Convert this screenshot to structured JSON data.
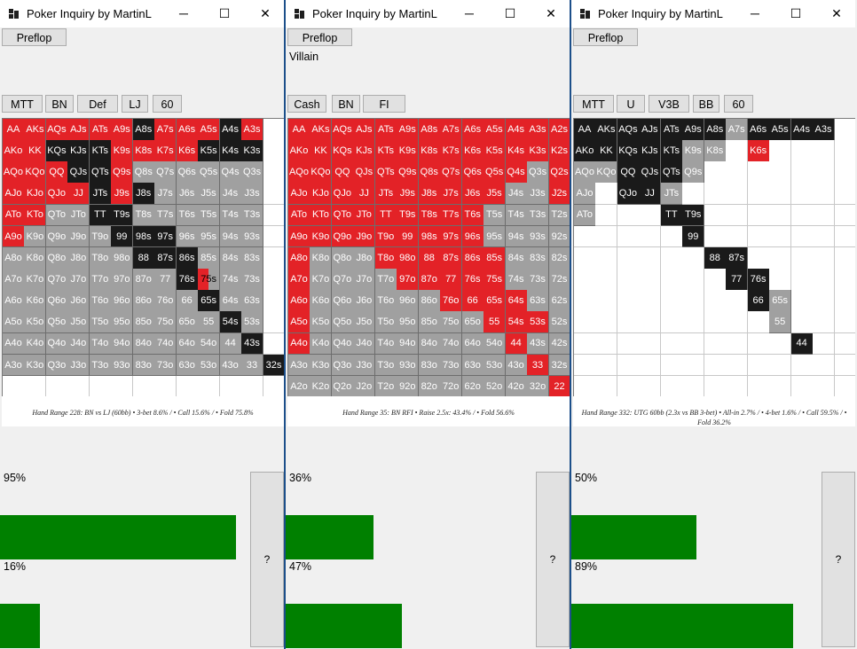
{
  "windows": [
    {
      "title": "Poker Inquiry by MartinL",
      "preflop_label": "Preflop",
      "villain_label": "",
      "tags": [
        "MTT",
        "BN",
        "Def",
        "LJ",
        "60"
      ],
      "range_caption": "Hand Range 228: BN vs LJ (60bb) • 3-bet 8.6% / • Call 15.6% / • Fold 75.8%",
      "meters": [
        {
          "label": "95%",
          "fill": 0.83
        },
        {
          "label": "16%",
          "fill": 0.14
        }
      ],
      "question_label": "?",
      "grid": [
        "RRRRRRKRRRKR",
        "RRKKKRRRRKKK",
        "RRRKKRGGGGGG",
        "RRRRKRKGGGGG",
        "RRGGKKGGGGGG",
        "RGGGGKKKGGGG",
        "GGGGGGKKKGGG",
        "GGGGGGGGKSGG",
        "GGGGGGGGGKGG",
        "GGGGGGGGGGKG",
        "GGGGGGGGGGGK",
        "GGGGGGGGGGGGK"
      ]
    },
    {
      "title": "Poker Inquiry by MartinL",
      "preflop_label": "Preflop",
      "villain_label": "Villain",
      "tags": [
        "Cash",
        "BN",
        "FI"
      ],
      "range_caption": "Hand Range 35: BN RFI • Raise 2.5x: 43.4% / • Fold 56.6%",
      "meters": [
        {
          "label": "36%",
          "fill": 0.31
        },
        {
          "label": "47%",
          "fill": 0.41
        }
      ],
      "question_label": "?",
      "grid": [
        "RRRRRRRRRRRRR",
        "RRRRRRRRRRRRR",
        "RRRRRRRRRRRGR",
        "RRRRRRRRRRGGR",
        "RRRRRRRRRGGGG",
        "RRRRRRRRRGGGG",
        "RGGGRRRRRRGGG",
        "RGGGGRRRRRGGG",
        "RGGGGGGRRRRGG",
        "RGGGGGGGGRRRG",
        "RGGGGGGGGGRGG",
        "GGGGGGGGGGGRG",
        "GGGGGGGGGGGGR"
      ]
    },
    {
      "title": "Poker Inquiry by MartinL",
      "preflop_label": "Preflop",
      "villain_label": "",
      "tags": [
        "MTT",
        "U",
        "V3B",
        "BB",
        "60"
      ],
      "range_caption": "Hand Range 332: UTG 60bb (2.3x vs BB 3-bet) • All-in 2.7% / • 4-bet 1.6% / • Call 59.5% / • Fold 36.2%",
      "meters": [
        {
          "label": "50%",
          "fill": 0.44
        },
        {
          "label": "89%",
          "fill": 0.78
        }
      ],
      "question_label": "?",
      "grid": [
        "KKKKKKKGKKKKW",
        "KKKKKGGWRWWWW",
        "GGKKKGWWWWWWW",
        "GWKKGWWWWWWWW",
        "GWWWKKWWWWWWW",
        "WWWWWKWWWWWWW",
        "WWWWWWKKWWWWW",
        "WWWWWWWKKWWWW",
        "WWWWWWWWKGWWW",
        "WWWWWWWWWGWWW",
        "WWWWWWWWWWKWW",
        "WWWWWWWWWWWWW",
        "WWWWWWWWWWWWW"
      ]
    }
  ],
  "hands": [
    [
      "AA",
      "AKs",
      "AQs",
      "AJs",
      "ATs",
      "A9s",
      "A8s",
      "A7s",
      "A6s",
      "A5s",
      "A4s",
      "A3s",
      "A2s"
    ],
    [
      "AKo",
      "KK",
      "KQs",
      "KJs",
      "KTs",
      "K9s",
      "K8s",
      "K7s",
      "K6s",
      "K5s",
      "K4s",
      "K3s",
      "K2s"
    ],
    [
      "AQo",
      "KQo",
      "QQ",
      "QJs",
      "QTs",
      "Q9s",
      "Q8s",
      "Q7s",
      "Q6s",
      "Q5s",
      "Q4s",
      "Q3s",
      "Q2s"
    ],
    [
      "AJo",
      "KJo",
      "QJo",
      "JJ",
      "JTs",
      "J9s",
      "J8s",
      "J7s",
      "J6s",
      "J5s",
      "J4s",
      "J3s",
      "J2s"
    ],
    [
      "ATo",
      "KTo",
      "QTo",
      "JTo",
      "TT",
      "T9s",
      "T8s",
      "T7s",
      "T6s",
      "T5s",
      "T4s",
      "T3s",
      "T2s"
    ],
    [
      "A9o",
      "K9o",
      "Q9o",
      "J9o",
      "T9o",
      "99",
      "98s",
      "97s",
      "96s",
      "95s",
      "94s",
      "93s",
      "92s"
    ],
    [
      "A8o",
      "K8o",
      "Q8o",
      "J8o",
      "T8o",
      "98o",
      "88",
      "87s",
      "86s",
      "85s",
      "84s",
      "83s",
      "82s"
    ],
    [
      "A7o",
      "K7o",
      "Q7o",
      "J7o",
      "T7o",
      "97o",
      "87o",
      "77",
      "76s",
      "75s",
      "74s",
      "73s",
      "72s"
    ],
    [
      "A6o",
      "K6o",
      "Q6o",
      "J6o",
      "T6o",
      "96o",
      "86o",
      "76o",
      "66",
      "65s",
      "64s",
      "63s",
      "62s"
    ],
    [
      "A5o",
      "K5o",
      "Q5o",
      "J5o",
      "T5o",
      "95o",
      "85o",
      "75o",
      "65o",
      "55",
      "54s",
      "53s",
      "52s"
    ],
    [
      "A4o",
      "K4o",
      "Q4o",
      "J4o",
      "T4o",
      "94o",
      "84o",
      "74o",
      "64o",
      "54o",
      "44",
      "43s",
      "42s"
    ],
    [
      "A3o",
      "K3o",
      "Q3o",
      "J3o",
      "T3o",
      "93o",
      "83o",
      "73o",
      "63o",
      "53o",
      "43o",
      "33",
      "32s"
    ],
    [
      "A2o",
      "K2o",
      "Q2o",
      "J2o",
      "T2o",
      "92o",
      "82o",
      "72o",
      "62o",
      "52o",
      "42o",
      "32o",
      "22"
    ]
  ],
  "colors": {
    "raise": "#e32227",
    "call": "#1a1a1a",
    "fold": "#a0a0a0",
    "none": "#ffffff",
    "bar": "#008000"
  }
}
